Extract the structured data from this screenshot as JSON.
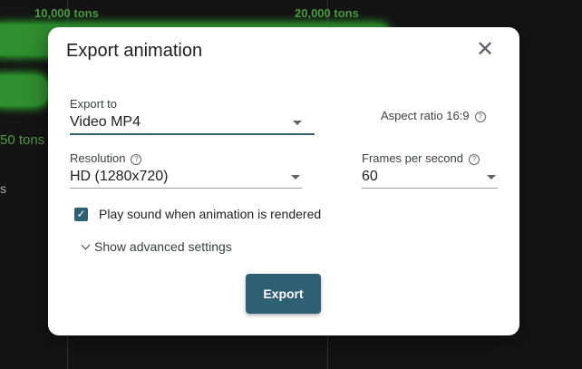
{
  "background": {
    "labels": [
      "10,000 tons",
      "20,000 tons",
      "50 tons",
      "s"
    ]
  },
  "dialog": {
    "title": "Export animation",
    "export_to": {
      "label": "Export to",
      "value": "Video MP4"
    },
    "aspect_ratio": "Aspect ratio 16:9",
    "resolution": {
      "label": "Resolution",
      "value": "HD (1280x720)"
    },
    "fps": {
      "label": "Frames per second",
      "value": "60"
    },
    "play_sound": {
      "label": "Play sound when animation is rendered",
      "checked": true
    },
    "advanced": "Show advanced settings",
    "export_button": "Export",
    "help_glyph": "?",
    "check_glyph": "✓",
    "close_glyph": "✕"
  },
  "colors": {
    "accent": "#2f5f73",
    "bar": "#2f8f2f",
    "bar_glow": "#35c535"
  }
}
